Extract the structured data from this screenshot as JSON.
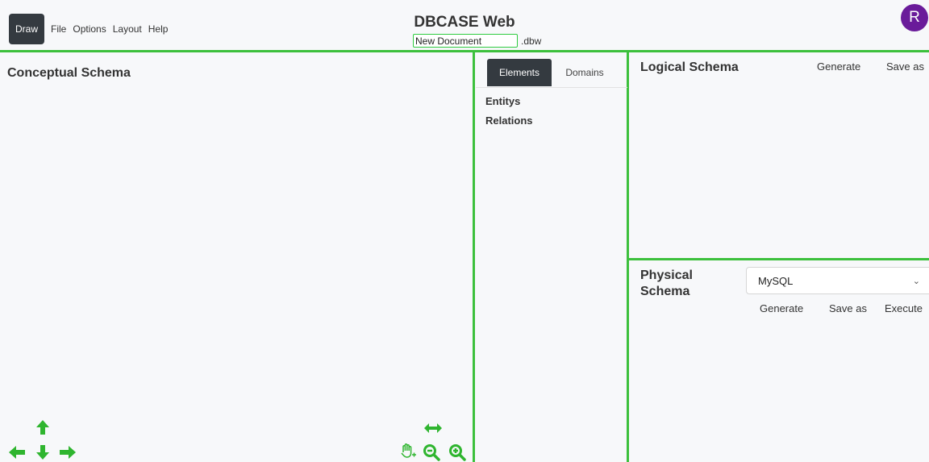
{
  "menu": {
    "items": [
      "Draw",
      "File",
      "Options",
      "Layout",
      "Help"
    ],
    "active": "Draw"
  },
  "app_title": "DBCASE Web",
  "document": {
    "name": "New Document",
    "extension": ".dbw"
  },
  "avatar_letter": "R",
  "conceptual": {
    "title": "Conceptual Schema"
  },
  "elements_panel": {
    "tabs": [
      {
        "label": "Elements",
        "active": true
      },
      {
        "label": "Domains",
        "active": false
      }
    ],
    "items": [
      "Entitys",
      "Relations"
    ]
  },
  "logical": {
    "title": "Logical Schema",
    "generate_label": "Generate",
    "save_label": "Save as"
  },
  "physical": {
    "title_line1": "Physical",
    "title_line2": "Schema",
    "db_selected": "MySQL",
    "generate_label": "Generate",
    "save_label": "Save as",
    "execute_label": "Execute"
  },
  "colors": {
    "accent_green": "#3cc03c",
    "icon_green": "#2fb52f",
    "dark": "#343a40",
    "avatar": "#6a1b9a"
  },
  "icons": [
    "arrow-up-icon",
    "arrow-left-icon",
    "arrow-down-icon",
    "arrow-right-icon",
    "resize-horizontal-icon",
    "pan-hand-icon",
    "zoom-out-icon",
    "zoom-in-icon"
  ]
}
